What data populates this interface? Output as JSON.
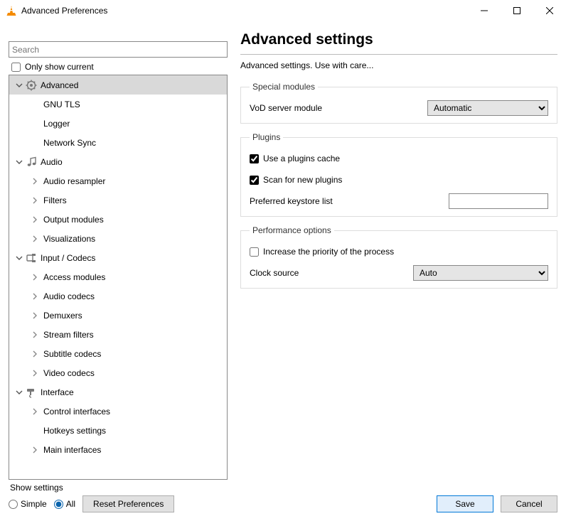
{
  "window": {
    "title": "Advanced Preferences"
  },
  "search": {
    "placeholder": "Search"
  },
  "only_show_current": {
    "label": "Only show current",
    "checked": false
  },
  "tree": [
    {
      "id": "advanced",
      "label": "Advanced",
      "level": 0,
      "expander": "down",
      "icon": "gear",
      "selected": true
    },
    {
      "id": "gnu-tls",
      "label": "GNU TLS",
      "level": 1,
      "expander": "none"
    },
    {
      "id": "logger",
      "label": "Logger",
      "level": 1,
      "expander": "none"
    },
    {
      "id": "network-sync",
      "label": "Network Sync",
      "level": 1,
      "expander": "none"
    },
    {
      "id": "audio",
      "label": "Audio",
      "level": 0,
      "expander": "down",
      "icon": "note"
    },
    {
      "id": "audio-resampler",
      "label": "Audio resampler",
      "level": 1,
      "expander": "right"
    },
    {
      "id": "filters",
      "label": "Filters",
      "level": 1,
      "expander": "right"
    },
    {
      "id": "output-modules",
      "label": "Output modules",
      "level": 1,
      "expander": "right"
    },
    {
      "id": "visualizations",
      "label": "Visualizations",
      "level": 1,
      "expander": "right"
    },
    {
      "id": "input-codecs",
      "label": "Input / Codecs",
      "level": 0,
      "expander": "down",
      "icon": "codec"
    },
    {
      "id": "access-modules",
      "label": "Access modules",
      "level": 1,
      "expander": "right"
    },
    {
      "id": "audio-codecs",
      "label": "Audio codecs",
      "level": 1,
      "expander": "right"
    },
    {
      "id": "demuxers",
      "label": "Demuxers",
      "level": 1,
      "expander": "right"
    },
    {
      "id": "stream-filters",
      "label": "Stream filters",
      "level": 1,
      "expander": "right"
    },
    {
      "id": "subtitle-codecs",
      "label": "Subtitle codecs",
      "level": 1,
      "expander": "right"
    },
    {
      "id": "video-codecs",
      "label": "Video codecs",
      "level": 1,
      "expander": "right"
    },
    {
      "id": "interface",
      "label": "Interface",
      "level": 0,
      "expander": "down",
      "icon": "brush"
    },
    {
      "id": "control-interfaces",
      "label": "Control interfaces",
      "level": 1,
      "expander": "right"
    },
    {
      "id": "hotkeys-settings",
      "label": "Hotkeys settings",
      "level": 1,
      "expander": "none"
    },
    {
      "id": "main-interfaces",
      "label": "Main interfaces",
      "level": 1,
      "expander": "right"
    }
  ],
  "page": {
    "heading": "Advanced settings",
    "subtitle": "Advanced settings. Use with care...",
    "groups": {
      "special": {
        "legend": "Special modules",
        "vod_label": "VoD server module",
        "vod_value": "Automatic"
      },
      "plugins": {
        "legend": "Plugins",
        "use_cache_label": "Use a plugins cache",
        "use_cache_checked": true,
        "scan_label": "Scan for new plugins",
        "scan_checked": true,
        "keystore_label": "Preferred keystore list",
        "keystore_value": ""
      },
      "perf": {
        "legend": "Performance options",
        "priority_label": "Increase the priority of the process",
        "priority_checked": false,
        "clock_label": "Clock source",
        "clock_value": "Auto"
      }
    }
  },
  "footer": {
    "show_settings_label": "Show settings",
    "simple_label": "Simple",
    "all_label": "All",
    "mode": "all",
    "reset_label": "Reset Preferences",
    "save_label": "Save",
    "cancel_label": "Cancel"
  }
}
